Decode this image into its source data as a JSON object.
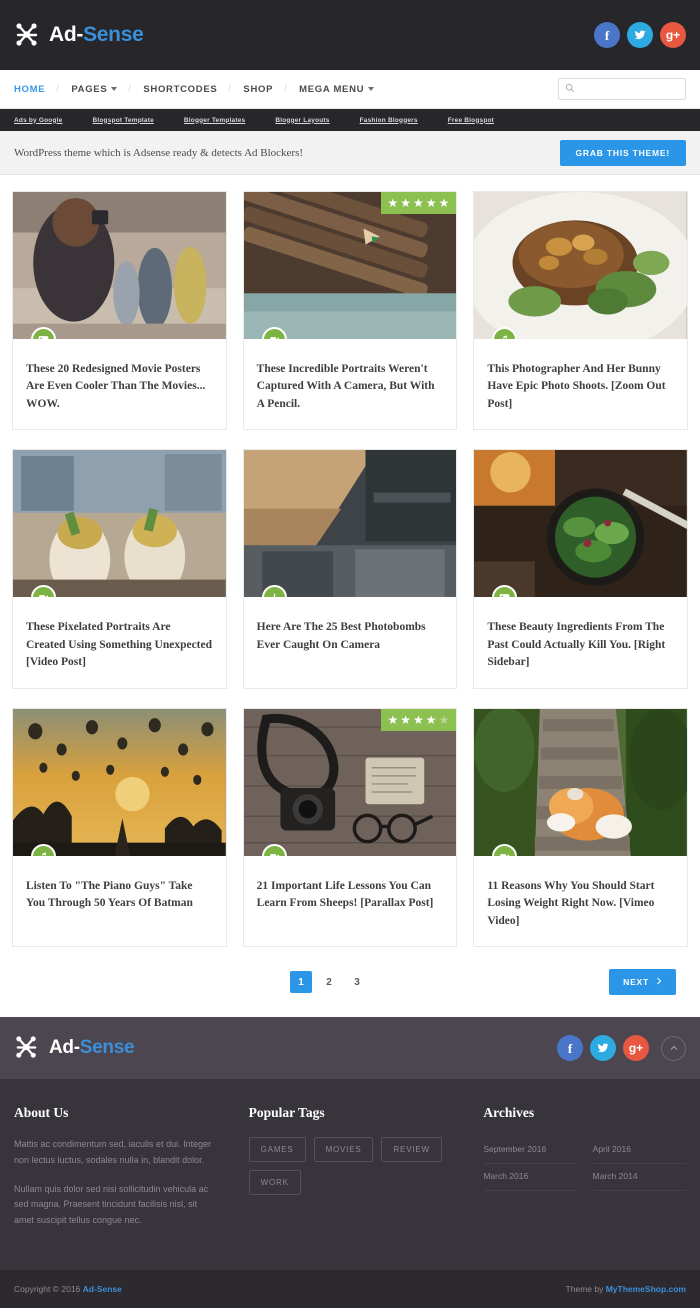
{
  "brand": {
    "name_prefix": "Ad-",
    "name_suffix": "Sense",
    "logo_icon": "molecule-x-icon",
    "accent_color": "#3a8fd8"
  },
  "header": {
    "social": [
      {
        "name": "facebook-icon",
        "glyph": "f",
        "color": "#4a76c7"
      },
      {
        "name": "twitter-icon",
        "glyph": "ᴠ",
        "color": "#2daae1"
      },
      {
        "name": "google-plus-icon",
        "glyph": "g+",
        "color": "#e8573f"
      }
    ]
  },
  "nav": {
    "items": [
      {
        "label": "HOME",
        "active": true,
        "dropdown": false
      },
      {
        "label": "PAGES",
        "active": false,
        "dropdown": true
      },
      {
        "label": "SHORTCODES",
        "active": false,
        "dropdown": false
      },
      {
        "label": "SHOP",
        "active": false,
        "dropdown": false
      },
      {
        "label": "MEGA MENU",
        "active": false,
        "dropdown": true
      }
    ],
    "search": {
      "value": "",
      "placeholder": "",
      "icon": "search-icon"
    }
  },
  "ads_bar": {
    "links": [
      "Ads by Google",
      "Blogspot Template",
      "Blogger Templates",
      "Blogger Layouts",
      "Fashion Bloggers",
      "Free Blogspot"
    ]
  },
  "promo": {
    "text": "WordPress theme which is Adsense ready & detects Ad Blockers!",
    "button_label": "GRAB THIS THEME!",
    "button_color": "#2b96e8"
  },
  "posts": [
    {
      "title": "These 20 Redesigned Movie Posters Are Even Cooler Than The Movies... WOW.",
      "format_icon": "image-icon",
      "rating": null,
      "thumb_alt": "woman photographing a crowded street"
    },
    {
      "title": "These Incredible Portraits Weren't Captured With A Camera, But With A Pencil.",
      "format_icon": "video-icon",
      "rating": 5,
      "thumb_alt": "row of sharpened colored pencils on teal wood"
    },
    {
      "title": "This Photographer And Her Bunny Have Epic Photo Shoots. [Zoom Out Post]",
      "format_icon": "music-icon",
      "rating": null,
      "thumb_alt": "grilled pork chop plated with broccoli"
    },
    {
      "title": "These Pixelated Portraits Are Created Using Something Unexpected [Video Post]",
      "format_icon": "video-icon",
      "rating": null,
      "thumb_alt": "two hands holding street food cones"
    },
    {
      "title": "Here Are The 25 Best Photobombs Ever Caught On Camera",
      "format_icon": "download-icon",
      "rating": null,
      "thumb_alt": "wooden desk corner with chair"
    },
    {
      "title": "These Beauty Ingredients From The Past Could Actually Kill You. [Right Sidebar]",
      "format_icon": "image-icon",
      "rating": null,
      "thumb_alt": "bowl of green salad on dark table"
    },
    {
      "title": "Listen To \"The Piano Guys\" Take You Through 50 Years Of Batman",
      "format_icon": "music-icon",
      "rating": null,
      "thumb_alt": "hot air balloons at golden sunset"
    },
    {
      "title": "21 Important Life Lessons You Can Learn From Sheeps! [Parallax Post]",
      "format_icon": "video-icon",
      "rating": 4,
      "thumb_alt": "vintage camera and glasses on wood"
    },
    {
      "title": "11 Reasons Why You Should Start Losing Weight Right Now. [Vimeo Video]",
      "format_icon": "video-icon",
      "rating": null,
      "thumb_alt": "orange cat lying on a garden path"
    }
  ],
  "pagination": {
    "pages": [
      {
        "label": "1",
        "current": true
      },
      {
        "label": "2",
        "current": false
      },
      {
        "label": "3",
        "current": false
      }
    ],
    "next_label": "NEXT",
    "next_icon": "chevron-right-icon"
  },
  "footer": {
    "scroll_top_icon": "chevron-up-icon",
    "social": [
      {
        "name": "facebook-icon",
        "glyph": "f",
        "color": "#4a76c7"
      },
      {
        "name": "twitter-icon",
        "glyph": "ᴠ",
        "color": "#2daae1"
      },
      {
        "name": "google-plus-icon",
        "glyph": "g+",
        "color": "#e8573f"
      }
    ],
    "about": {
      "title": "About Us",
      "paragraph1": "Mattis ac condimentum sed, iaculis et dui. Integer non lectus luctus, sodales nulla in, blandit dolor.",
      "paragraph2": "Nullam quis dolor sed nisi sollicitudin vehicula ac sed magna. Praesent tincidunt facilisis nisl, sit amet suscipit tellus congue nec."
    },
    "tags": {
      "title": "Popular Tags",
      "items": [
        "GAMES",
        "MOVIES",
        "REVIEW",
        "WORK"
      ]
    },
    "archives": {
      "title": "Archives",
      "items": [
        "September 2016",
        "April 2016",
        "March 2016",
        "March 2014"
      ]
    },
    "copyright_prefix": "Copyright © 2016 ",
    "copyright_brand": "Ad-Sense",
    "credit_prefix": "Theme by ",
    "credit_link": "MyThemeShop.com"
  }
}
